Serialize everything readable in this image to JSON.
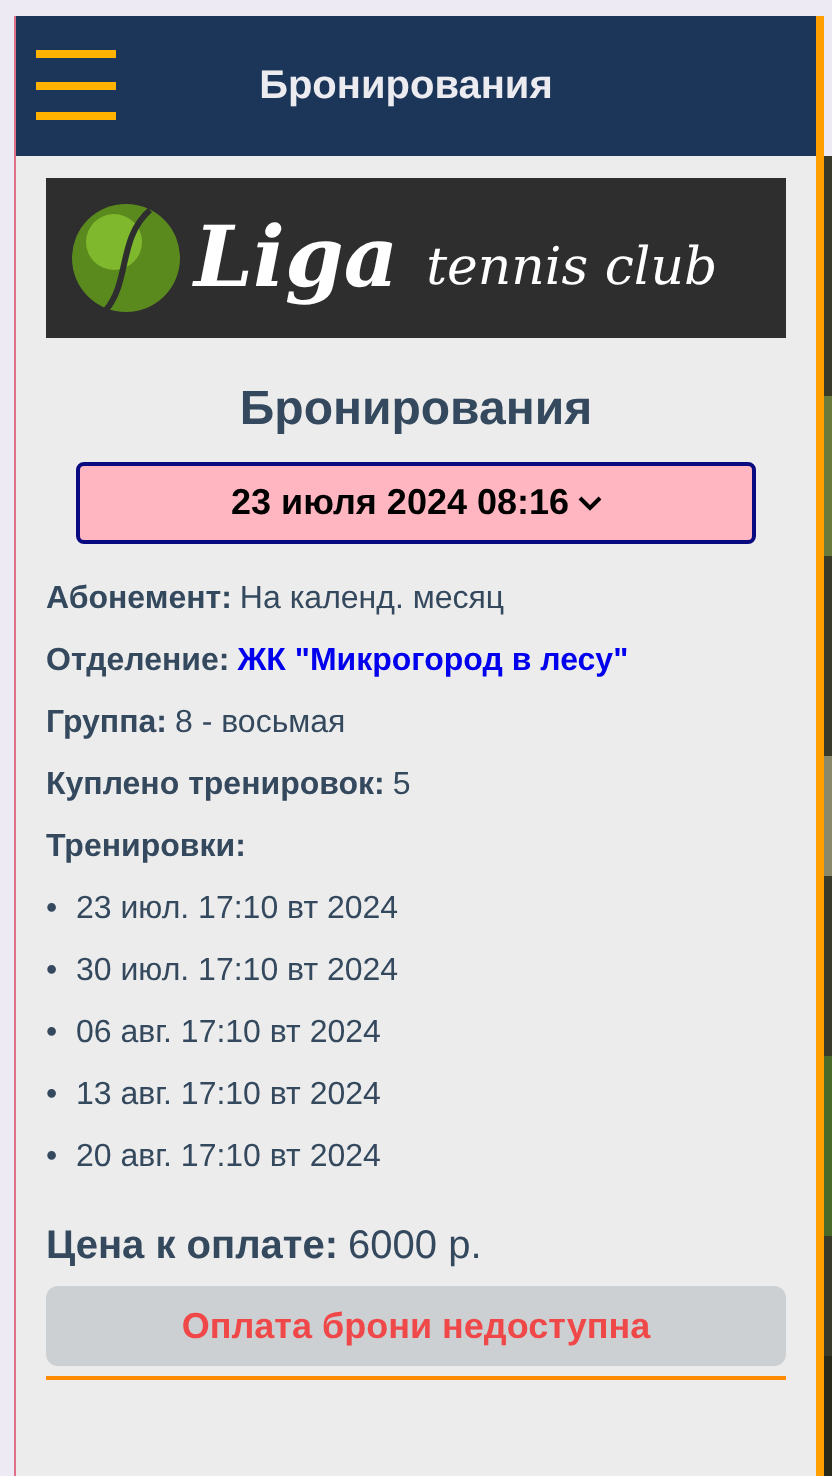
{
  "header": {
    "title": "Бронирования"
  },
  "logo": {
    "brand": "Liga",
    "tagline": "tennis club"
  },
  "heading": "Бронирования",
  "date_select": {
    "value": "23 июля 2024 08:16"
  },
  "details": [
    {
      "label": "Абонемент:",
      "value": "На календ. месяц",
      "kind": "text"
    },
    {
      "label": "Отделение:",
      "value": "ЖК \"Микрогород в лесу\"",
      "kind": "link"
    },
    {
      "label": "Группа:",
      "value": "8 - восьмая",
      "kind": "text"
    },
    {
      "label": "Куплено тренировок:",
      "value": "5",
      "kind": "text"
    }
  ],
  "trainings": {
    "label": "Тренировки:",
    "bullet": "•",
    "items": [
      "23 июл. 17:10 вт 2024",
      "30 июл. 17:10 вт 2024",
      "06 авг. 17:10 вт 2024",
      "13 авг. 17:10 вт 2024",
      "20 авг. 17:10 вт 2024"
    ]
  },
  "price": {
    "label": "Цена к оплате:",
    "value": "6000 р."
  },
  "pay_button": {
    "label": "Оплата брони недоступна",
    "disabled": true
  }
}
